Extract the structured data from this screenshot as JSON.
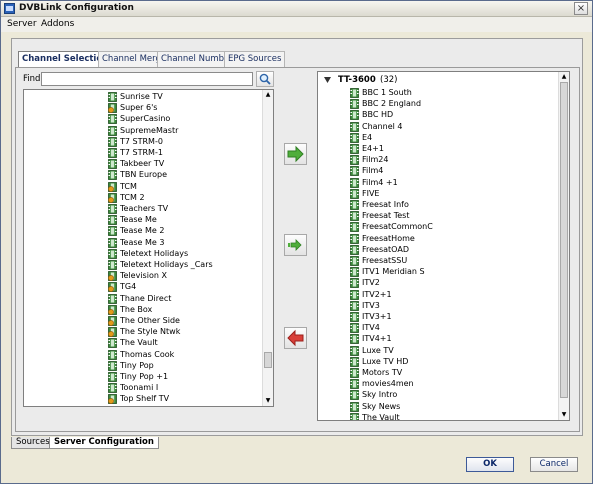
{
  "window": {
    "title": "DVBLink Configuration",
    "close_glyph": "×"
  },
  "menu": {
    "items": [
      "Server",
      "Addons"
    ]
  },
  "tabs": [
    {
      "label": "Channel Selection",
      "active": true
    },
    {
      "label": "Channel Merge",
      "active": false
    },
    {
      "label": "Channel Numbers",
      "active": false
    },
    {
      "label": "EPG Sources",
      "active": false
    }
  ],
  "find": {
    "label": "Find:",
    "value": ""
  },
  "left_list": {
    "channels": [
      {
        "name": "Sunrise TV",
        "icon": "tv-channel-icon"
      },
      {
        "name": "Super 6's",
        "icon": "radio-channel-icon"
      },
      {
        "name": "SuperCasino",
        "icon": "tv-channel-icon"
      },
      {
        "name": "SupremeMastr",
        "icon": "tv-channel-icon"
      },
      {
        "name": "T7 STRM-0",
        "icon": "tv-channel-icon"
      },
      {
        "name": "T7 STRM-1",
        "icon": "tv-channel-icon"
      },
      {
        "name": "Takbeer TV",
        "icon": "tv-channel-icon"
      },
      {
        "name": "TBN Europe",
        "icon": "tv-channel-icon"
      },
      {
        "name": "TCM",
        "icon": "radio-channel-icon"
      },
      {
        "name": "TCM 2",
        "icon": "radio-channel-icon"
      },
      {
        "name": "Teachers TV",
        "icon": "tv-channel-icon"
      },
      {
        "name": "Tease Me",
        "icon": "tv-channel-icon"
      },
      {
        "name": "Tease Me 2",
        "icon": "tv-channel-icon"
      },
      {
        "name": "Tease Me 3",
        "icon": "tv-channel-icon"
      },
      {
        "name": "Teletext Holidays",
        "icon": "tv-channel-icon"
      },
      {
        "name": "Teletext Holidays _Cars",
        "icon": "tv-channel-icon"
      },
      {
        "name": "Television X",
        "icon": "radio-channel-icon"
      },
      {
        "name": "TG4",
        "icon": "radio-channel-icon"
      },
      {
        "name": "Thane Direct",
        "icon": "tv-channel-icon"
      },
      {
        "name": "The Box",
        "icon": "radio-channel-icon"
      },
      {
        "name": "The Other Side",
        "icon": "radio-channel-icon"
      },
      {
        "name": "The Style Ntwk",
        "icon": "radio-channel-icon"
      },
      {
        "name": "The Vault",
        "icon": "tv-channel-icon"
      },
      {
        "name": "Thomas Cook",
        "icon": "tv-channel-icon"
      },
      {
        "name": "Tiny Pop",
        "icon": "tv-channel-icon"
      },
      {
        "name": "Tiny Pop +1",
        "icon": "tv-channel-icon"
      },
      {
        "name": "Toonami I",
        "icon": "tv-channel-icon"
      },
      {
        "name": "Top Shelf TV",
        "icon": "radio-channel-icon"
      }
    ]
  },
  "right_list": {
    "source_name": "TT-3600",
    "source_count": "(32)",
    "channels": [
      "BBC 1 South",
      "BBC 2 England",
      "BBC HD",
      "Channel 4",
      "E4",
      "E4+1",
      "Film24",
      "Film4",
      "Film4 +1",
      "FIVE",
      "Freesat Info",
      "Freesat Test",
      "FreesatCommonC",
      "FreesatHome",
      "FreesatOAD",
      "FreesatSSU",
      "ITV1 Meridian S",
      "ITV2",
      "ITV2+1",
      "ITV3",
      "ITV3+1",
      "ITV4",
      "ITV4+1",
      "Luxe TV",
      "Luxe TV HD",
      "Motors TV",
      "movies4men",
      "Sky Intro",
      "Sky News",
      "The Vault"
    ]
  },
  "scroll": {
    "up_glyph": "▲",
    "down_glyph": "▼"
  },
  "bottom_tabs": [
    {
      "label": "Sources",
      "active": false
    },
    {
      "label": "Server Configuration",
      "active": true
    }
  ],
  "buttons": {
    "ok": "OK",
    "cancel": "Cancel"
  },
  "colors": {
    "tv_icon_green": "#3c8a3c",
    "radio_icon_orange": "#e19a1a",
    "arrow_green": "#4fae3b",
    "arrow_red": "#d9403a"
  }
}
